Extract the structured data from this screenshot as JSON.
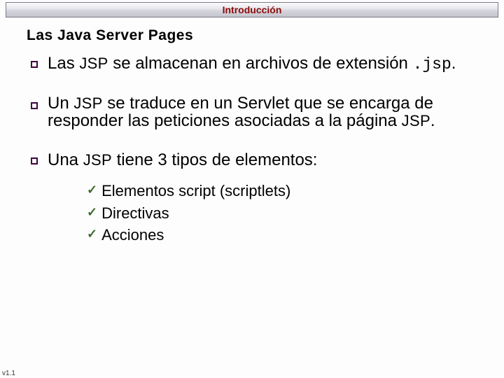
{
  "header": {
    "title": "Introducción"
  },
  "page_title": "Las Java Server Pages",
  "bullets": {
    "b1": {
      "pre": "Las ",
      "sc1": "JSP",
      "mid": " se almacenan en archivos de extensión ",
      "mono": ".jsp",
      "post": "."
    },
    "b2": {
      "pre": "Un ",
      "sc1": "JSP",
      "mid": " se traduce en un Servlet  que se encarga de responder las peticiones asociadas a la página  ",
      "sc2": "JSP",
      "post": "."
    },
    "b3": {
      "pre": "Una ",
      "sc1": "JSP",
      "post": " tiene 3 tipos de elementos:"
    }
  },
  "checks": {
    "c1": "Elementos script (scriptlets)",
    "c2": "Directivas",
    "c3": "Acciones"
  },
  "version": "v1.1"
}
